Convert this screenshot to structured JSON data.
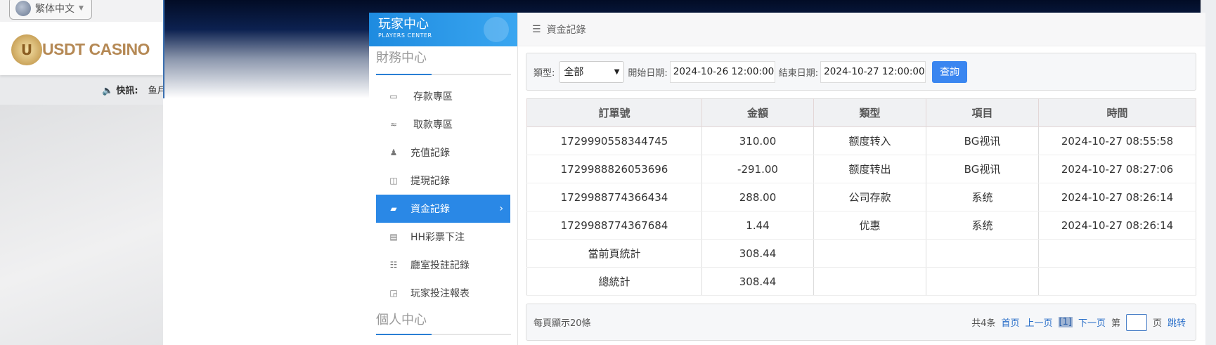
{
  "site": {
    "language": "繁体中文",
    "logo_text": "USDT CASINO",
    "news_label": "快訊:",
    "news_text": "鱼戶"
  },
  "sidebar": {
    "title": "玩家中心",
    "subtitle": "PLAYERS CENTER",
    "section_finance": "財務中心",
    "section_personal": "個人中心",
    "items": [
      {
        "label": "存款專區",
        "icon": "card-icon"
      },
      {
        "label": "取款專區",
        "icon": "cash-hand-icon"
      },
      {
        "label": "充值記錄",
        "icon": "money-bag-icon"
      },
      {
        "label": "提現記錄",
        "icon": "wallet-icon"
      },
      {
        "label": "資金記錄",
        "icon": "funds-icon",
        "active": true
      },
      {
        "label": "HH彩票下注",
        "icon": "ticket-icon"
      },
      {
        "label": "廳室投註記錄",
        "icon": "list-icon"
      },
      {
        "label": "玩家投注報表",
        "icon": "chart-icon"
      }
    ]
  },
  "breadcrumb": "資金記錄",
  "filter": {
    "type_label": "類型:",
    "type_value": "全部",
    "start_label": "開始日期:",
    "start_value": "2024-10-26 12:00:00",
    "end_label": "結束日期:",
    "end_value": "2024-10-27 12:00:00",
    "query_button": "查詢"
  },
  "table": {
    "headers": [
      "訂單號",
      "金額",
      "類型",
      "項目",
      "時間"
    ],
    "rows": [
      [
        "1729990558344745",
        "310.00",
        "额度转入",
        "BG视讯",
        "2024-10-27 08:55:58"
      ],
      [
        "1729988826053696",
        "-291.00",
        "额度转出",
        "BG视讯",
        "2024-10-27 08:27:06"
      ],
      [
        "1729988774366434",
        "288.00",
        "公司存款",
        "系统",
        "2024-10-27 08:26:14"
      ],
      [
        "1729988774367684",
        "1.44",
        "优惠",
        "系统",
        "2024-10-27 08:26:14"
      ]
    ],
    "page_total_label": "當前頁統計",
    "page_total": "308.44",
    "grand_total_label": "總統計",
    "grand_total": "308.44"
  },
  "footer": {
    "per_page": "每頁顯示20條",
    "total": "共4条",
    "first": "首页",
    "prev": "上一页",
    "current": "[1]",
    "next": "下一页",
    "page_prefix": "第",
    "page_input": "",
    "page_suffix": "页",
    "jump": "跳转"
  },
  "colors": {
    "accent": "#2a88e6",
    "button": "#3a86f0"
  }
}
